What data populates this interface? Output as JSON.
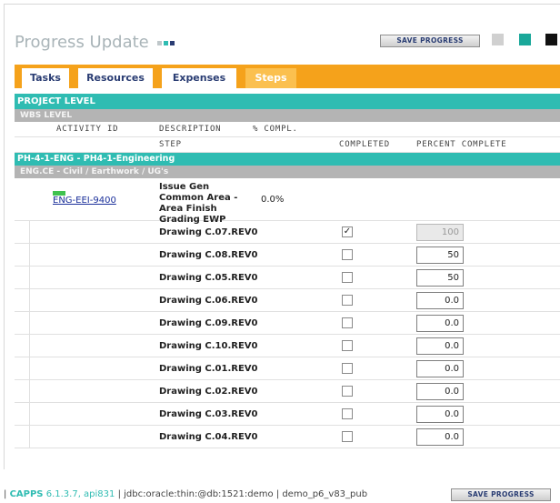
{
  "header": {
    "title": "Progress Update",
    "title_squares": [
      "#bfc7ca",
      "#2fbcb2",
      "#2a3d73"
    ],
    "save_label": "SAVE PROGRESS",
    "controls": [
      "#d0d0d0",
      "#1aa89a",
      "#111111"
    ]
  },
  "tabs": [
    {
      "label": "Tasks",
      "active": false
    },
    {
      "label": "Resources",
      "active": false
    },
    {
      "label": "Expenses",
      "active": false
    },
    {
      "label": "Steps",
      "active": true
    }
  ],
  "table": {
    "project_level": "PROJECT LEVEL",
    "wbs_level": "WBS LEVEL",
    "columns": {
      "activity_id": "ACTIVITY ID",
      "description": "DESCRIPTION",
      "pct_compl": "% COMPL.",
      "step": "STEP",
      "completed": "COMPLETED",
      "percent_complete": "PERCENT COMPLETE"
    },
    "activity_group": "PH-4-1-ENG - PH4-1-Engineering",
    "wbs_group": "ENG.CE - Civil / Earthwork / UG's",
    "activity": {
      "id": "ENG-EEI-9400",
      "description": "Issue Gen Common Area - Area Finish Grading EWP",
      "pct": "0.0%"
    },
    "steps": [
      {
        "name": "Drawing C.07.REV0",
        "checked": true,
        "check_mark": "✓",
        "pct": "100",
        "disabled": true
      },
      {
        "name": "Drawing C.08.REV0",
        "checked": false,
        "check_mark": "",
        "pct": "50",
        "disabled": false
      },
      {
        "name": "Drawing C.05.REV0",
        "checked": false,
        "check_mark": "",
        "pct": "50",
        "disabled": false
      },
      {
        "name": "Drawing C.06.REV0",
        "checked": false,
        "check_mark": "",
        "pct": "0.0",
        "disabled": false
      },
      {
        "name": "Drawing C.09.REV0",
        "checked": false,
        "check_mark": "",
        "pct": "0.0",
        "disabled": false
      },
      {
        "name": "Drawing C.10.REV0",
        "checked": false,
        "check_mark": "",
        "pct": "0.0",
        "disabled": false
      },
      {
        "name": "Drawing C.01.REV0",
        "checked": false,
        "check_mark": "",
        "pct": "0.0",
        "disabled": false
      },
      {
        "name": "Drawing C.02.REV0",
        "checked": false,
        "check_mark": "",
        "pct": "0.0",
        "disabled": false
      },
      {
        "name": "Drawing C.03.REV0",
        "checked": false,
        "check_mark": "",
        "pct": "0.0",
        "disabled": false
      },
      {
        "name": "Drawing C.04.REV0",
        "checked": false,
        "check_mark": "",
        "pct": "0.0",
        "disabled": false
      }
    ]
  },
  "footer": {
    "separator": "|",
    "brand": "CAPPS",
    "version": "6.1.3.7, api831",
    "connection": "| jdbc:oracle:thin:@db:1521:demo | demo_p6_v83_pub",
    "save_label": "SAVE PROGRESS"
  },
  "colors": {
    "accent_teal": "#2fbcb2",
    "tab_bar": "#f5a21b",
    "tab_active": "#fbc04f",
    "link": "#1a2f9a"
  }
}
